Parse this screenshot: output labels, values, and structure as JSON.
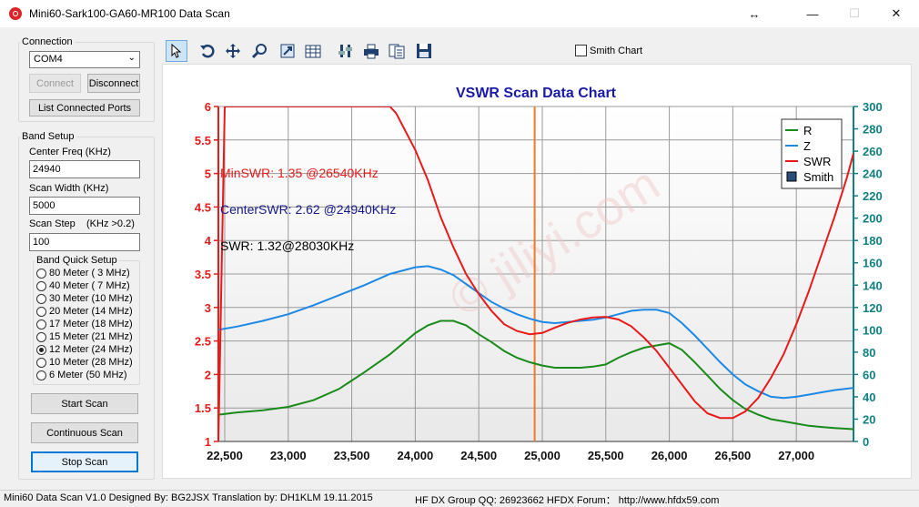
{
  "window": {
    "title": "Mini60-Sark100-GA60-MR100 Data Scan",
    "resize_icon": "↔",
    "min_icon": "—",
    "max_icon": "☐",
    "close_icon": "✕"
  },
  "connection": {
    "label": "Connection",
    "port": "COM4",
    "connect_label": "Connect",
    "disconnect_label": "Disconnect",
    "list_ports_label": "List Connected Ports"
  },
  "band_setup": {
    "label": "Band Setup",
    "center_freq_label": "Center Freq  (KHz)",
    "center_freq_value": "24940",
    "scan_width_label": "Scan Width   (KHz)",
    "scan_width_value": "5000",
    "scan_step_label": "Scan Step",
    "scan_step_hint": "(KHz >0.2)",
    "scan_step_value": "100",
    "quick_label": "Band Quick Setup",
    "bands": [
      {
        "label": "80 Meter  ( 3 MHz)",
        "checked": false
      },
      {
        "label": "40 Meter  ( 7 MHz)",
        "checked": false
      },
      {
        "label": "30 Meter  (10 MHz)",
        "checked": false
      },
      {
        "label": "20 Meter  (14 MHz)",
        "checked": false
      },
      {
        "label": "17 Meter  (18 MHz)",
        "checked": false
      },
      {
        "label": "15 Meter  (21 MHz)",
        "checked": false
      },
      {
        "label": "12 Meter  (24 MHz)",
        "checked": true
      },
      {
        "label": "10 Meter  (28 MHz)",
        "checked": false
      },
      {
        "label": "6 Meter   (50 MHz)",
        "checked": false
      }
    ]
  },
  "actions": {
    "start_scan": "Start Scan",
    "continuous_scan": "Continuous Scan",
    "stop_scan": "Stop Scan"
  },
  "toolbar": {
    "icons": [
      "pointer-icon",
      "undo-icon",
      "move-icon",
      "zoom-icon",
      "export-icon",
      "grid-icon",
      "settings-icon",
      "print-icon",
      "copy-icon",
      "save-icon"
    ],
    "smith_chart_label": "Smith Chart"
  },
  "chart_data": {
    "type": "line",
    "title": "VSWR Scan Data Chart",
    "xlim": [
      22450,
      27450
    ],
    "x_ticks": [
      22500,
      23000,
      23500,
      24000,
      24500,
      25000,
      25500,
      26000,
      26500,
      27000
    ],
    "x_tick_labels": [
      "22,500",
      "23,000",
      "23,500",
      "24,000",
      "24,500",
      "25,000",
      "25,500",
      "26,000",
      "26,500",
      "27,000"
    ],
    "y_left_lim": [
      1,
      6
    ],
    "y_left_ticks": [
      "1",
      "1.5",
      "2",
      "2.5",
      "3",
      "3.5",
      "4",
      "4.5",
      "5",
      "5.5",
      "6"
    ],
    "y_right_lim": [
      0,
      300
    ],
    "y_right_ticks": [
      "0",
      "20",
      "40",
      "60",
      "80",
      "100",
      "120",
      "140",
      "160",
      "180",
      "200",
      "220",
      "240",
      "260",
      "280",
      "300"
    ],
    "center_marker_x": 24940,
    "legend": [
      {
        "name": "R",
        "color": "#1a8a1a"
      },
      {
        "name": "Z",
        "color": "#1e88e5"
      },
      {
        "name": "SWR",
        "color": "#e81a1a"
      },
      {
        "name": "Smith",
        "color": "#2b4d7a"
      }
    ],
    "annotations": [
      {
        "text": "MinSWR: 1.35 @26540KHz",
        "color": "#e81a1a"
      },
      {
        "text": "CenterSWR: 2.62 @24940KHz",
        "color": "#1a1a8a"
      },
      {
        "text": "SWR: 1.32@28030KHz",
        "color": "#000000"
      }
    ],
    "watermark": "© jiliyi.com",
    "series": [
      {
        "name": "SWR",
        "axis": "left",
        "color": "#e81a1a",
        "x": [
          22450,
          22500,
          23000,
          23500,
          23700,
          23800,
          23850,
          24000,
          24100,
          24200,
          24300,
          24400,
          24500,
          24600,
          24700,
          24800,
          24900,
          25000,
          25100,
          25200,
          25300,
          25400,
          25500,
          25600,
          25700,
          25800,
          25900,
          26000,
          26100,
          26200,
          26300,
          26400,
          26500,
          26600,
          26650,
          26700,
          26800,
          26900,
          27000,
          27100,
          27200,
          27300,
          27400,
          27450
        ],
        "y": [
          1.0,
          6.0,
          6.0,
          6.0,
          6.0,
          6.0,
          5.9,
          5.35,
          4.9,
          4.35,
          3.9,
          3.5,
          3.2,
          2.95,
          2.75,
          2.65,
          2.6,
          2.62,
          2.7,
          2.77,
          2.82,
          2.85,
          2.86,
          2.82,
          2.72,
          2.55,
          2.35,
          2.1,
          1.85,
          1.6,
          1.42,
          1.35,
          1.35,
          1.45,
          1.55,
          1.65,
          1.95,
          2.3,
          2.75,
          3.25,
          3.8,
          4.35,
          4.95,
          5.3
        ]
      },
      {
        "name": "Z",
        "axis": "right",
        "color": "#1e88e5",
        "x": [
          22450,
          22600,
          22800,
          23000,
          23200,
          23400,
          23600,
          23800,
          24000,
          24100,
          24200,
          24300,
          24400,
          24500,
          24600,
          24700,
          24800,
          24900,
          25000,
          25100,
          25200,
          25300,
          25400,
          25500,
          25600,
          25700,
          25800,
          25900,
          26000,
          26100,
          26200,
          26300,
          26400,
          26500,
          26600,
          26700,
          26800,
          26900,
          27000,
          27100,
          27200,
          27300,
          27450
        ],
        "y": [
          100,
          103,
          108,
          114,
          122,
          131,
          140,
          150,
          156,
          157,
          154,
          149,
          141,
          133,
          125,
          119,
          114,
          110,
          107,
          106,
          107,
          108,
          109,
          111,
          114,
          117,
          118,
          118,
          115,
          106,
          95,
          83,
          71,
          60,
          51,
          45,
          40,
          39,
          40,
          42,
          44,
          46,
          48
        ]
      },
      {
        "name": "R",
        "axis": "right",
        "color": "#1a8a1a",
        "x": [
          22450,
          22600,
          22800,
          23000,
          23200,
          23400,
          23600,
          23800,
          24000,
          24100,
          24200,
          24300,
          24400,
          24500,
          24600,
          24700,
          24800,
          24900,
          25000,
          25100,
          25200,
          25300,
          25400,
          25500,
          25600,
          25700,
          25800,
          25900,
          26000,
          26100,
          26200,
          26300,
          26400,
          26500,
          26600,
          26700,
          26800,
          26900,
          27000,
          27100,
          27200,
          27300,
          27450
        ],
        "y": [
          24,
          26,
          28,
          31,
          37,
          47,
          62,
          78,
          97,
          104,
          108,
          108,
          104,
          96,
          89,
          81,
          75,
          71,
          68,
          66,
          66,
          66,
          67,
          69,
          75,
          80,
          84,
          86,
          88,
          82,
          71,
          59,
          47,
          37,
          29,
          24,
          20,
          18,
          16,
          14,
          13,
          12,
          11
        ]
      }
    ]
  },
  "status": {
    "left": "Mini60 Data Scan V1.0   Designed By: BG2JSX   Translation by: DH1KLM    19.11.2015",
    "right": "HF DX Group QQ: 26923662   HFDX Forum：  http://www.hfdx59.com"
  }
}
